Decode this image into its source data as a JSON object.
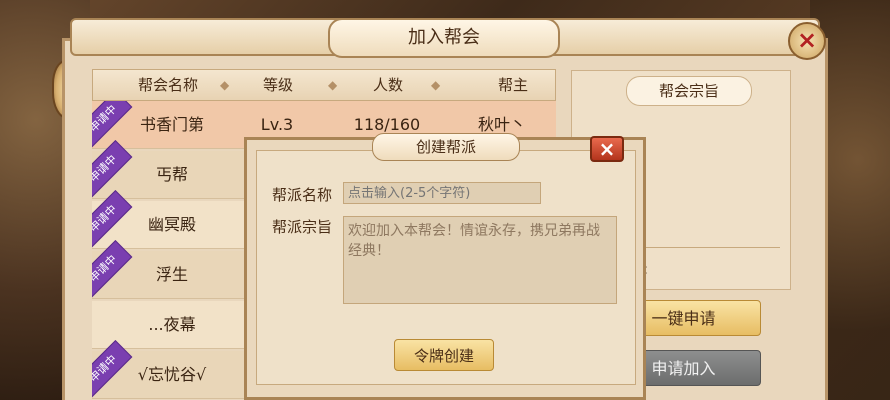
{
  "window": {
    "title": "加入帮会",
    "close_icon": "×"
  },
  "table": {
    "headers": [
      "帮会名称",
      "等级",
      "人数",
      "帮主"
    ],
    "header_separator": "◆",
    "badge_text": "申请中",
    "rows": [
      {
        "name": "书香门第",
        "level": "Lv.3",
        "members": "118/160",
        "leader": "秋叶丶",
        "applying": true
      },
      {
        "name": "丐帮",
        "level": "",
        "members": "",
        "leader": "",
        "applying": true
      },
      {
        "name": "幽冥殿",
        "level": "",
        "members": "",
        "leader": "",
        "applying": true
      },
      {
        "name": "浮生",
        "level": "",
        "members": "",
        "leader": "",
        "applying": true
      },
      {
        "name": "...夜幕",
        "level": "",
        "members": "",
        "leader": "",
        "applying": false
      },
      {
        "name": "√忘忧谷√",
        "level": "",
        "members": "",
        "leader": "",
        "applying": true
      }
    ]
  },
  "right_panel": {
    "purpose_title": "帮会宗旨",
    "leader_label_partial": "名:",
    "one_click_button": "一键申请",
    "apply_button": "申请加入"
  },
  "dialog": {
    "title": "创建帮派",
    "close_icon": "×",
    "name_label": "帮派名称",
    "name_placeholder": "点击输入(2-5个字符)",
    "purpose_label": "帮派宗旨",
    "purpose_value": "欢迎加入本帮会！情谊永存，携兄弟再战经典！",
    "create_button": "令牌创建"
  },
  "colors": {
    "panel_bg": "#e9d7bd",
    "badge_purple": "#7a3fb0",
    "gold_button": "#e7bd63",
    "gray_button": "#6c6d6d",
    "close_red": "#b3341c"
  }
}
